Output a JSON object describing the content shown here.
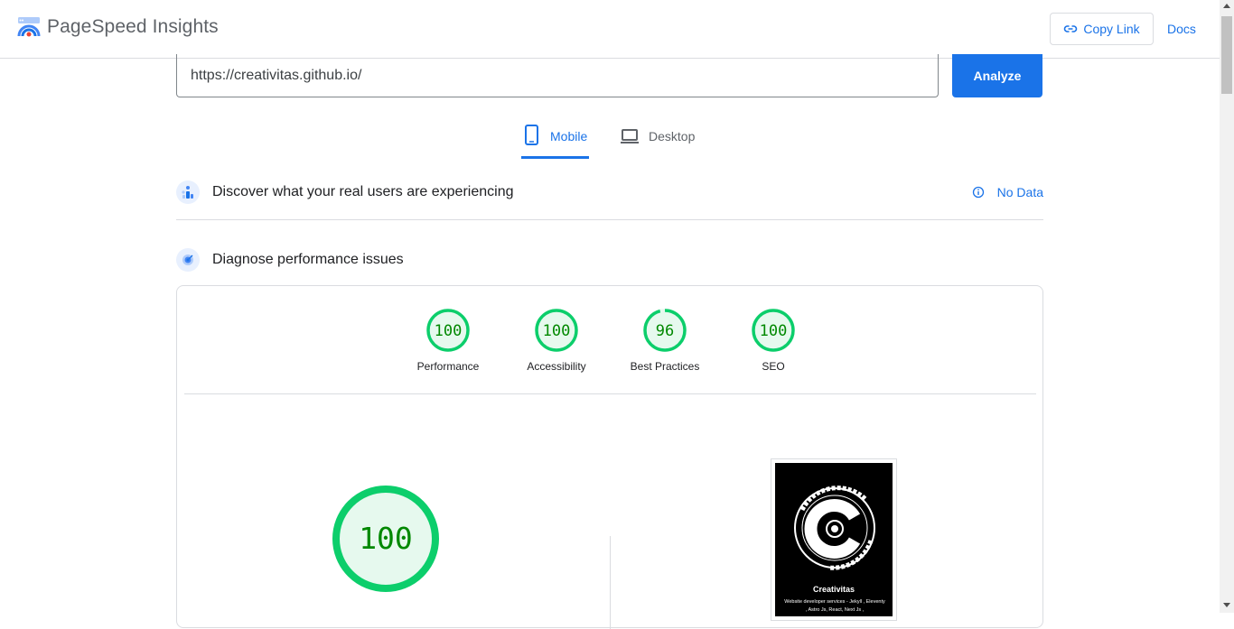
{
  "header": {
    "app_title": "PageSpeed Insights",
    "copy_link_label": "Copy Link",
    "docs_label": "Docs"
  },
  "search": {
    "url_value": "https://creativitas.github.io/",
    "analyze_label": "Analyze"
  },
  "tabs": [
    {
      "label": "Mobile",
      "active": true
    },
    {
      "label": "Desktop",
      "active": false
    }
  ],
  "crux": {
    "title": "Discover what your real users are experiencing",
    "status_label": "No Data"
  },
  "diagnose": {
    "title": "Diagnose performance issues"
  },
  "scores": [
    {
      "label": "Performance",
      "value": 100
    },
    {
      "label": "Accessibility",
      "value": 100
    },
    {
      "label": "Best Practices",
      "value": 96
    },
    {
      "label": "SEO",
      "value": 100
    }
  ],
  "main_score": {
    "value": 100
  },
  "screenshot": {
    "site_title": "Creativitas",
    "site_description": "Website developer services - Jekyll , Eleventy , Astro Js, React, Next Js ,"
  },
  "colors": {
    "accent": "#1a73e8",
    "pass": "#0cce6b",
    "pass_text": "#008800",
    "pass_fill": "#e6f9ee"
  }
}
